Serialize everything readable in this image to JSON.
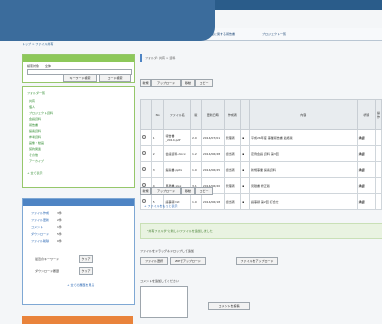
{
  "nav": {
    "site_button": "ポータル",
    "links": [
      "トップページ",
      "プロジェクト管理ツール",
      "プロジェクト・ファイル・事業",
      "過去事業に関する報告書",
      "プロジェクト一覧"
    ]
  },
  "breadcrumb": "トップ > ファイル共有",
  "sidebar": {
    "search": {
      "label_left": "検索対象",
      "label_right": "全体",
      "keyword_button": "キーワード検索",
      "code_button": "コード検索"
    },
    "folders": {
      "title": "フォルダ一覧",
      "items": [
        "共有",
        "個人",
        "プロジェクト資料",
        "会議資料",
        "報告書",
        "提案資料",
        "参考資料",
        "画像・動画",
        "契約関連",
        "その他",
        "アーカイブ"
      ],
      "more": "+ 全て表示"
    },
    "recent": {
      "rows": [
        {
          "name": "ファイル作成",
          "count": "3件"
        },
        {
          "name": "ファイル更新",
          "count": "2件"
        },
        {
          "name": "コメント",
          "count": "1件"
        },
        {
          "name": "ダウンロード",
          "count": "5件"
        },
        {
          "name": "ファイル削除",
          "count": "0件"
        }
      ],
      "filters": [
        {
          "label": "最近のキーワード",
          "button": "クリア"
        },
        {
          "label": "ダウンロード履歴",
          "button": "クリア"
        }
      ],
      "footer": "+ 全ての履歴を見る"
    }
  },
  "main": {
    "file_section_title": "フォルダ: 共有 > 資料",
    "toolbar": {
      "new": "新規",
      "upload": "アップロード",
      "move": "移動",
      "copy": "コピー"
    },
    "table": {
      "headers": [
        "",
        "No",
        "ファイル名",
        "版",
        "更新日時",
        "作成者",
        "",
        "内容",
        "状態",
        "操作"
      ],
      "rows": [
        {
          "no": "1",
          "file": "報告書_2014.pdf",
          "ver": "2.0",
          "date": "2014/07/01",
          "author": "管理者",
          "content": "平成26年度 事業報告書 最終版",
          "status": "承認"
        },
        {
          "no": "2",
          "file": "会議資料.docx",
          "ver": "1.2",
          "date": "2014/06/28",
          "author": "担当者",
          "content": "定例会議 資料 第3回",
          "status": "承認"
        },
        {
          "no": "3",
          "file": "提案書.pptx",
          "ver": "1.0",
          "date": "2014/06/25",
          "author": "担当者",
          "content": "新規事業 提案資料",
          "status": "承認"
        },
        {
          "no": "4",
          "file": "見積書.xlsx",
          "ver": "3.1",
          "date": "2014/06/20",
          "author": "管理者",
          "content": "見積書 修正版",
          "status": "承認"
        },
        {
          "no": "5",
          "file": "議事録.txt",
          "ver": "1.0",
          "date": "2014/06/18",
          "author": "担当者",
          "content": "議事録 第2回 打合せ",
          "status": "承認"
        }
      ]
    },
    "more_link": "+ ファイルをもっと表示",
    "notice": "\"共有フォルダ\"に新しいファイルを追加しました",
    "upload_label": "ファイルをドラッグ＆ドロップして追加",
    "upload_buttons": {
      "select": "ファイル選択",
      "zip": "ZIPでアップロード",
      "submit": "ファイルをアップロード"
    },
    "comment_label": "コメントを追加してください",
    "comment_submit": "コメントを投稿"
  },
  "colors": {
    "header": "#2a5c8a",
    "green_panel": "#8dc85a",
    "blue_panel": "#4e84c4",
    "accent": "#e9833b"
  }
}
